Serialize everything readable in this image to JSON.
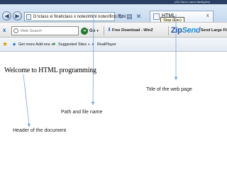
{
  "window": {
    "title_text": "(20) Sarvo, sarvo family(ies)"
  },
  "address_bar": {
    "url": "D:\\class xi final\\class x notes\\html notes\\first.html"
  },
  "tab": {
    "title": "HTML",
    "close_label": "x"
  },
  "tooltip": {
    "text": "Stop (Esc)"
  },
  "search_toolbar": {
    "placeholder": "Web Search",
    "go_label": "Go",
    "free_download_label": "Free Download - WinZ",
    "zip_logo_part1": "Zip",
    "zip_logo_part2": "Send",
    "send_large_label": "Send Large Files"
  },
  "favorites_bar": {
    "items": [
      {
        "label": "Get more Add-ons",
        "icon": "addons-icon"
      },
      {
        "label": "Suggested Sites",
        "icon": "suggested-sites-icon"
      },
      {
        "label": "RealPlayer",
        "icon": "realplayer-icon"
      }
    ]
  },
  "page": {
    "heading": "Welcome to HTML programming"
  },
  "annotations": {
    "title_callout": "Title of the web page",
    "path_callout": "Path and file name",
    "header_callout": "Header of the document"
  },
  "colors": {
    "annotation_arrow": "#7aa6e0",
    "frame_blue": "#2b3f62"
  }
}
